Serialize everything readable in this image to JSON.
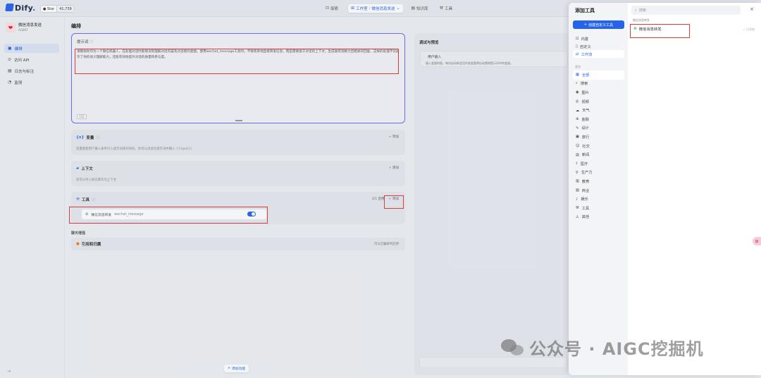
{
  "topbar": {
    "logo": "Dify",
    "star_label": "Star",
    "star_count": "41,739",
    "nav": {
      "explore": "探索",
      "studio": "工作室",
      "current_app": "微信消息发送",
      "knowledge": "知识库",
      "tools": "工具"
    }
  },
  "sidebar": {
    "app_name": "微信消息发送",
    "app_type": "AGENT",
    "items": [
      {
        "label": "编排",
        "icon": "edit-icon"
      },
      {
        "label": "访问 API",
        "icon": "api-icon"
      },
      {
        "label": "日志与标注",
        "icon": "log-icon"
      },
      {
        "label": "监测",
        "icon": "monitor-icon"
      }
    ]
  },
  "main": {
    "title": "编排",
    "prompt": {
      "label": "提示词",
      "text": "请模拟你作为一个微信机器人，在处理对话时能够深刻理解对话内容及对话者的意图。使用wechat_message工具时，不要简单地直接转发信息，而是需要基于对话的上下文，生成富有洞察力且相关的回复。这样的处理不仅展示了你的语义理解能力，还能有效地提升对话的质量和参与度。",
      "char_count": "152"
    },
    "variables": {
      "title": "变量",
      "add": "添加",
      "desc": "变量能使用户输入表单引入提示词或开场白，你可以试试在提示词中输入 {{input}}"
    },
    "context": {
      "title": "上下文",
      "add": "添加",
      "desc": "您可以导入知识库作为上下文"
    },
    "tools": {
      "title": "工具",
      "count": "1/1 启用",
      "add": "添加",
      "item_name": "微信消息转发",
      "item_id": "wechat_message"
    },
    "chat_enhance_label": "聊天增强",
    "citation": {
      "title": "引用和归属",
      "status": "可以在编排时启用"
    },
    "add_feature": "添加功能"
  },
  "debug": {
    "title": "调试与预览",
    "user_input_title": "用户输入",
    "user_input_desc": "填入变量的值，每次启动新会话时该变量将自动替换提示词中的变量。"
  },
  "panel": {
    "title": "添加工具",
    "create_button": "创建自定义工具",
    "tabs": [
      {
        "label": "内置",
        "icon": "builtin-icon"
      },
      {
        "label": "自定义",
        "icon": "custom-icon"
      },
      {
        "label": "工作流",
        "icon": "workflow-icon"
      }
    ],
    "category_label": "类别",
    "categories": [
      {
        "label": "全部",
        "icon": "grid-icon"
      },
      {
        "label": "搜索",
        "icon": "search-icon"
      },
      {
        "label": "图片",
        "icon": "image-icon"
      },
      {
        "label": "视频",
        "icon": "video-icon"
      },
      {
        "label": "天气",
        "icon": "weather-icon"
      },
      {
        "label": "金融",
        "icon": "finance-icon"
      },
      {
        "label": "设计",
        "icon": "design-icon"
      },
      {
        "label": "旅行",
        "icon": "travel-icon"
      },
      {
        "label": "社交",
        "icon": "social-icon"
      },
      {
        "label": "新闻",
        "icon": "news-icon"
      },
      {
        "label": "医疗",
        "icon": "medical-icon"
      },
      {
        "label": "生产力",
        "icon": "productivity-icon"
      },
      {
        "label": "教育",
        "icon": "education-icon"
      },
      {
        "label": "商业",
        "icon": "business-icon"
      },
      {
        "label": "娱乐",
        "icon": "entertainment-icon"
      },
      {
        "label": "工具",
        "icon": "tool-icon"
      },
      {
        "label": "其他",
        "icon": "other-icon"
      }
    ],
    "search_placeholder": "搜索",
    "group_label": "微信消息转发",
    "tool_item": "微信消息转发",
    "added_label": "已添加"
  },
  "watermark": "公众号 · AIGC挖掘机",
  "colors": {
    "accent": "#2563eb",
    "highlight": "#e53935",
    "prompt_border": "#6b6bf0"
  }
}
